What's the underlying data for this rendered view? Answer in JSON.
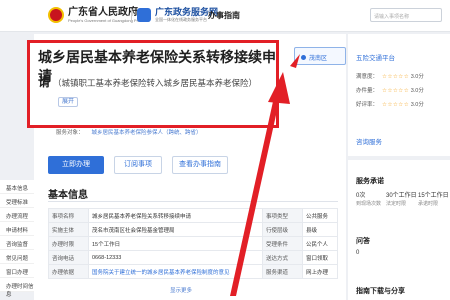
{
  "header": {
    "gov_name": "广东省人民政府",
    "gov_sub": "People's Government of Guangdong Province",
    "service_name": "广东政务服务网",
    "service_sub": "全国一体化在线政务服务平台",
    "nav_link": "办事指南",
    "search_placeholder": "请输入事项名称"
  },
  "left_tabs": [
    "基本信息",
    "受理标准",
    "办理流程",
    "申请材料",
    "咨询监督",
    "常见问题",
    "窗口办理",
    "办理时间信息"
  ],
  "title": "城乡居民基本养老保险关系转移接续申请",
  "subtitle_lead": "请",
  "subtitle_rest": "（城镇职工基本养老保险转入城乡居民基本养老保险）",
  "expand_label": "展开",
  "region_button": "茂南区",
  "scope": {
    "label": "服务对象：",
    "value": "城乡居民基本养老保险参保人（跨统、跨省）"
  },
  "buttons": {
    "apply": "立即办理",
    "subscribe": "订阅事项",
    "help": "查看办事指南"
  },
  "basic_info": {
    "heading": "基本信息",
    "rows": [
      [
        "事项名称",
        "城乡居民基本养老保险关系转移接续申请",
        "事项类型",
        "公共服务"
      ],
      [
        "实施主体",
        "茂名市茂南区社会保险基金管理局",
        "行使层级",
        "县级"
      ],
      [
        "办理时限",
        "15个工作日",
        "受理条件",
        "公民个人"
      ],
      [
        "咨询电话",
        "0668-12333",
        "送达方式",
        "窗口领取"
      ],
      [
        "办理依据",
        "国务院关于建立统一的城乡居民基本养老保险制度的意见",
        "服务渠道",
        "网上办理"
      ]
    ],
    "more_label": "显示更多"
  },
  "right_top": {
    "link1": "五险交通平台",
    "rating_label": "满意度：",
    "rating_value": "3.0分",
    "rating2_label": "办件量：",
    "rating2_value": "3.0分",
    "rating3_label": "好评率：",
    "rating3_value": "3.0分",
    "consult": "咨询服务"
  },
  "right_bottom": {
    "heading1": "服务承诺",
    "stats": [
      {
        "num": "0次",
        "label": "到现场次数"
      },
      {
        "num": "30个工作日",
        "label": "法定时限"
      },
      {
        "num": "15个工作日",
        "label": "承诺时限"
      }
    ],
    "heading2": "问答",
    "q_count": "0",
    "heading3": "指南下载与分享"
  },
  "colors": {
    "accent": "#2f6fd8",
    "highlight": "#e21f26"
  }
}
